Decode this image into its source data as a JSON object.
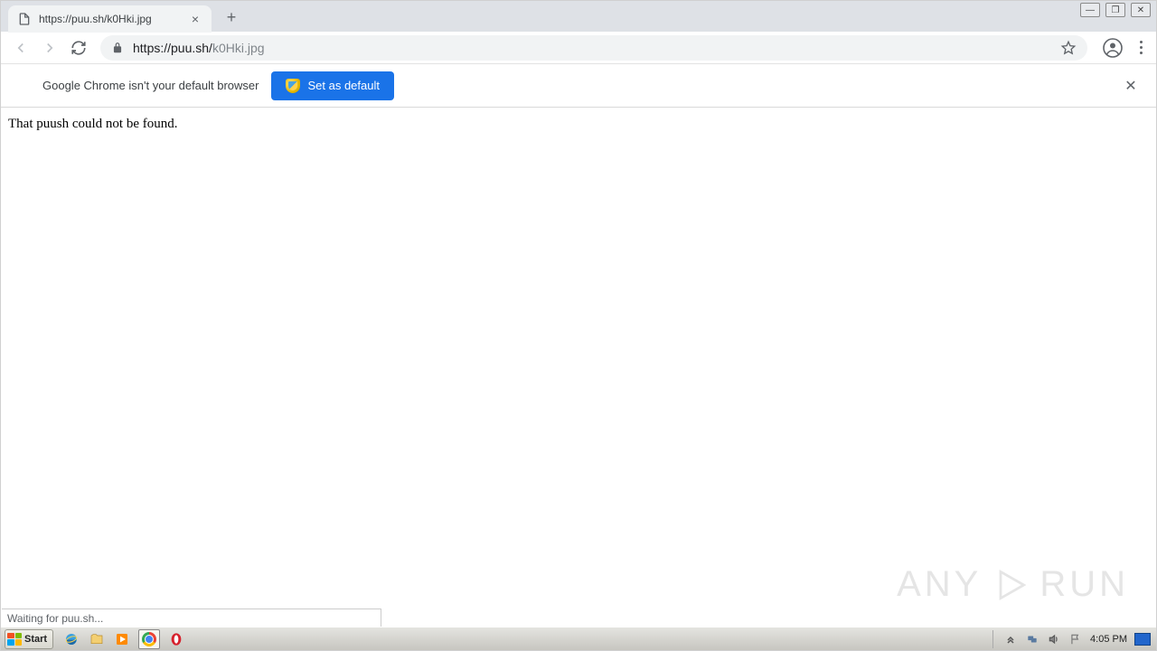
{
  "tab": {
    "title": "https://puu.sh/k0Hki.jpg"
  },
  "omnibox": {
    "url_prefix": "https://puu.sh/",
    "url_path": "k0Hki.jpg"
  },
  "infobar": {
    "message": "Google Chrome isn't your default browser",
    "button_label": "Set as default"
  },
  "page": {
    "body_text": "That puush could not be found."
  },
  "status": {
    "text": "Waiting for puu.sh..."
  },
  "watermark": {
    "left": "ANY",
    "right": "RUN"
  },
  "taskbar": {
    "start_label": "Start",
    "clock": "4:05 PM"
  }
}
